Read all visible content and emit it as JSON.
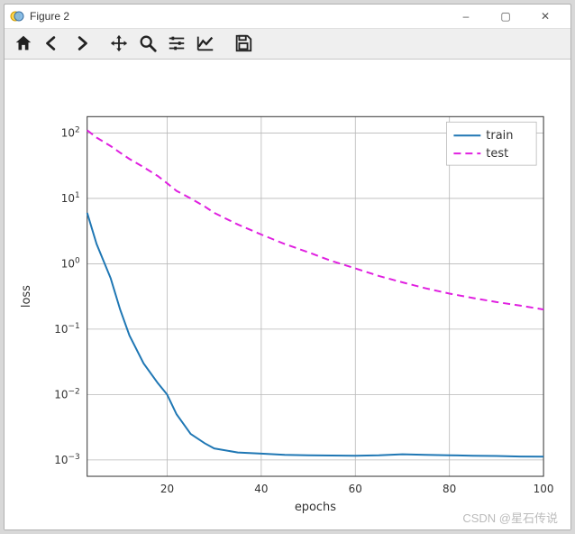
{
  "window": {
    "title": "Figure 2",
    "buttons": {
      "minimize": "–",
      "maximize": "▢",
      "close": "✕"
    }
  },
  "toolbar": {
    "home": "home-icon",
    "back": "arrow-left-icon",
    "forward": "arrow-right-icon",
    "pan": "move-icon",
    "zoom": "magnify-icon",
    "configure": "sliders-icon",
    "axes": "chart-line-icon",
    "save": "save-icon"
  },
  "watermark": "CSDN @星石传说",
  "chart_data": {
    "type": "line",
    "xlabel": "epochs",
    "ylabel": "loss",
    "xticks": [
      20,
      40,
      60,
      80,
      100
    ],
    "yticks_exp": [
      -3,
      -2,
      -1,
      0,
      1,
      2
    ],
    "ytick_labels": [
      "10⁻³",
      "10⁻²",
      "10⁻¹",
      "10⁰",
      "10¹",
      "10²"
    ],
    "xlim": [
      3,
      100
    ],
    "ylim_log10": [
      -3.25,
      2.25
    ],
    "legend": [
      "train",
      "test"
    ],
    "x": [
      3,
      5,
      8,
      10,
      12,
      15,
      18,
      20,
      22,
      25,
      28,
      30,
      35,
      40,
      45,
      50,
      55,
      60,
      65,
      70,
      75,
      80,
      85,
      90,
      95,
      100
    ],
    "series": [
      {
        "name": "train",
        "values": [
          6.0,
          2.0,
          0.6,
          0.2,
          0.08,
          0.03,
          0.015,
          0.01,
          0.005,
          0.0025,
          0.0018,
          0.0015,
          0.0013,
          0.00125,
          0.0012,
          0.00118,
          0.00117,
          0.00116,
          0.00118,
          0.00122,
          0.0012,
          0.00118,
          0.00116,
          0.00115,
          0.00113,
          0.00112
        ]
      },
      {
        "name": "test",
        "values": [
          110,
          85,
          63,
          50,
          40,
          30,
          22,
          17,
          13,
          10,
          7.5,
          6.0,
          4.0,
          2.8,
          2.0,
          1.5,
          1.1,
          0.85,
          0.65,
          0.52,
          0.42,
          0.35,
          0.3,
          0.26,
          0.23,
          0.2
        ]
      }
    ]
  }
}
